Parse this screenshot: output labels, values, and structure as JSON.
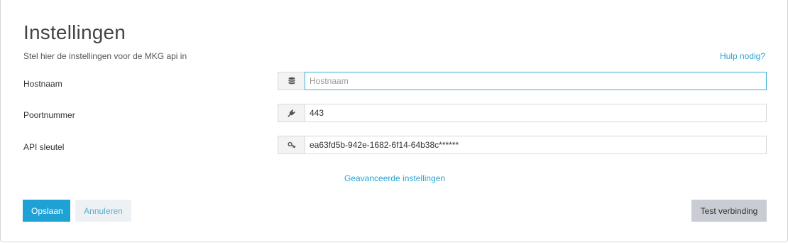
{
  "header": {
    "title": "Instellingen",
    "subtitle": "Stel hier de instellingen voor de MKG api in",
    "help_link": "Hulp nodig?"
  },
  "form": {
    "hostname": {
      "label": "Hostnaam",
      "value": "",
      "placeholder": "Hostnaam",
      "icon": "database-icon"
    },
    "port": {
      "label": "Poortnummer",
      "value": "443",
      "icon": "plug-icon"
    },
    "api_key": {
      "label": "API sleutel",
      "value": "ea63fd5b-942e-1682-6f14-64b38c******",
      "icon": "key-icon"
    }
  },
  "advanced_link": "Geavanceerde instellingen",
  "actions": {
    "save_label": "Opslaan",
    "cancel_label": "Annuleren",
    "test_label": "Test verbinding"
  },
  "colors": {
    "accent": "#1ea2d6",
    "link": "#2aa3d0",
    "focus_border": "#3db0d6",
    "test_button_bg": "#c9cdd3",
    "cancel_button_bg": "#eef1f4"
  }
}
